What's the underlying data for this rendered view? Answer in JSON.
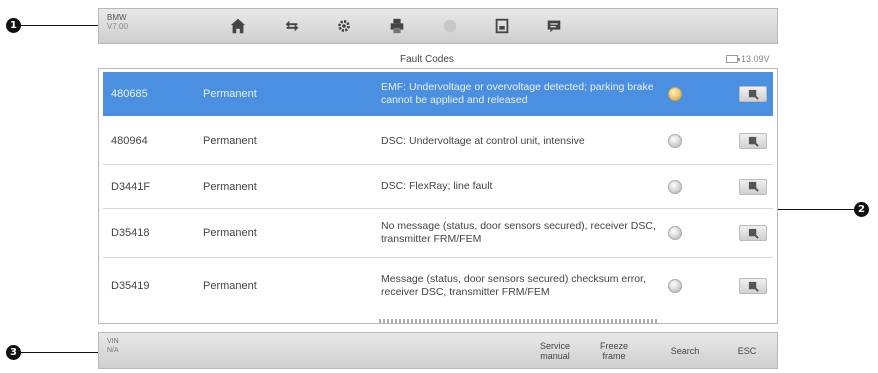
{
  "callouts": {
    "one": "1",
    "two": "2",
    "three": "3"
  },
  "toolbar": {
    "vehicle_make": "BMW",
    "vehicle_sub": "V7.00",
    "icons": [
      "home-icon",
      "vehicle-swap-icon",
      "settings-icon",
      "print-icon",
      "help-icon",
      "save-icon",
      "data-logging-icon"
    ]
  },
  "header": {
    "title": "Fault Codes",
    "battery": "13.09V"
  },
  "fault_codes": [
    {
      "code": "480685",
      "status": "Permanent",
      "description": "EMF: Undervoltage or overvoltage detected; parking brake cannot be applied and released",
      "selected": true
    },
    {
      "code": "480964",
      "status": "Permanent",
      "description": "DSC: Undervoltage at control unit, intensive",
      "selected": false
    },
    {
      "code": "D3441F",
      "status": "Permanent",
      "description": "DSC: FlexRay; line fault",
      "selected": false
    },
    {
      "code": "D35418",
      "status": "Permanent",
      "description": "No message (status, door sensors secured), receiver DSC, transmitter FRM/FEM",
      "selected": false
    },
    {
      "code": "D35419",
      "status": "Permanent",
      "description": "Message (status, door sensors secured) checksum error, receiver DSC, transmitter FRM/FEM",
      "selected": false
    }
  ],
  "bottombar": {
    "vin_label": "VIN",
    "vin_value": "N/A",
    "buttons": {
      "service_manual": "Service manual",
      "freeze_frame": "Freeze frame",
      "search": "Search",
      "esc": "ESC"
    }
  },
  "colors": {
    "selected_row": "#4a8fe0",
    "toolbar": "#dcdcdc"
  }
}
